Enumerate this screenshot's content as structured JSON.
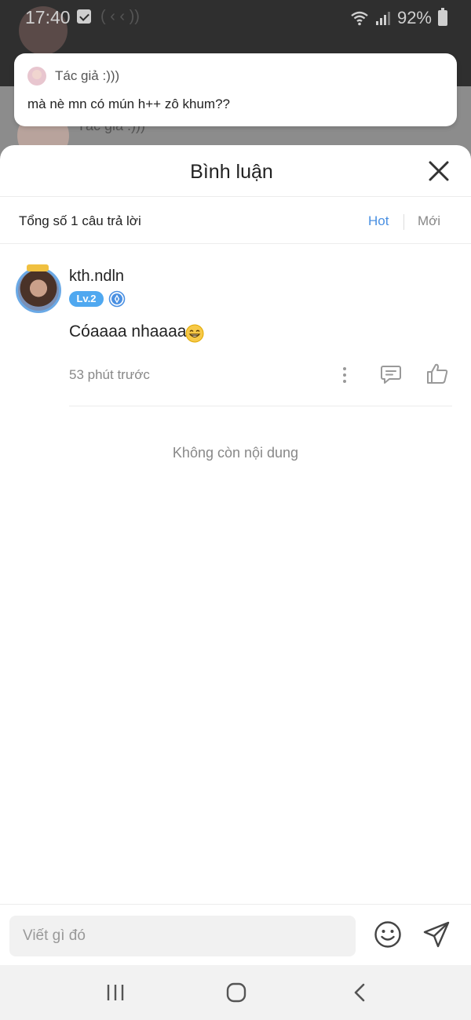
{
  "status_bar": {
    "time": "17:40",
    "faint_text": "( ‹ ‹ ))",
    "battery": "92%"
  },
  "background": {
    "author_label": "Tác giả :)))"
  },
  "notification": {
    "author": "Tác giả :)))",
    "message": "mà nè mn có mún h++ zô khum??"
  },
  "sheet": {
    "title": "Bình luận",
    "total_label": "Tổng số 1 câu trả lời",
    "sort_hot": "Hot",
    "sort_new": "Mới"
  },
  "comments": [
    {
      "username": "kth.ndln",
      "level": "Lv.2",
      "text": "Cóaaaa nhaaaa",
      "time": "53 phút trước"
    }
  ],
  "no_more_label": "Không còn nội dung",
  "input": {
    "placeholder": "Viết gì đó"
  },
  "colors": {
    "accent": "#4a90e2",
    "level_badge": "#4fa8f0",
    "sheet_bg": "#ffffff"
  },
  "icons": {
    "close": "close-icon",
    "more": "more-vertical-icon",
    "reply": "comment-bubble-icon",
    "like": "thumbs-up-icon",
    "emoji": "smiley-icon",
    "send": "send-icon"
  }
}
